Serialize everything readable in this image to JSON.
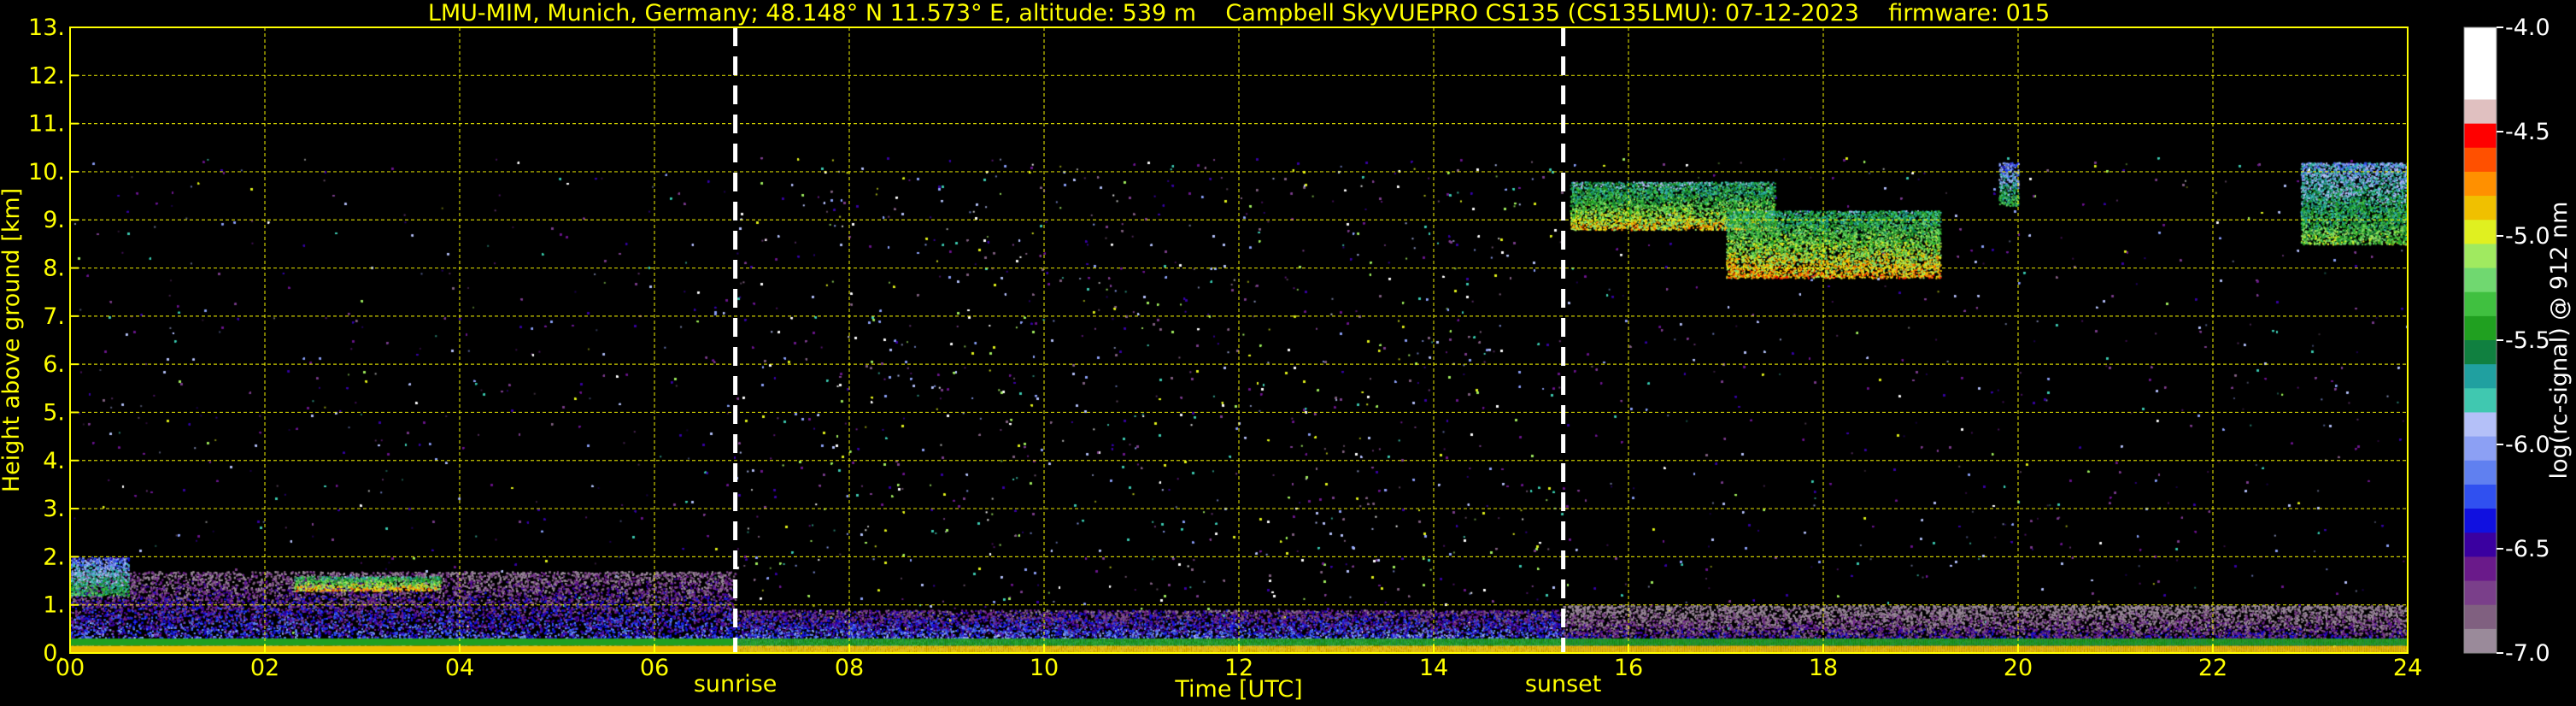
{
  "chart_data": {
    "type": "heatmap",
    "title": "LMU-MIM, Munich, Germany; 48.148° N 11.573° E, altitude: 539 m    Campbell SkyVUEPRO CS135 (CS135LMU): 07-12-2023    firmware: 015",
    "xlabel": "Time [UTC]",
    "ylabel": "Height above ground [km]",
    "xlim": [
      0,
      24
    ],
    "ylim": [
      0,
      13
    ],
    "xticks": [
      0,
      2,
      4,
      6,
      8,
      10,
      12,
      14,
      16,
      18,
      20,
      22,
      24
    ],
    "xtick_labels": [
      "00",
      "02",
      "04",
      "06",
      "08",
      "10",
      "12",
      "14",
      "16",
      "18",
      "20",
      "22",
      "24"
    ],
    "yticks": [
      0,
      1,
      2,
      3,
      4,
      5,
      6,
      7,
      8,
      9,
      10,
      11,
      12,
      13
    ],
    "ytick_labels": [
      "0.",
      "1.",
      "2.",
      "3.",
      "4.",
      "5.",
      "6.",
      "7.",
      "8.",
      "9.",
      "10.",
      "11.",
      "12.",
      "13."
    ],
    "grid": true,
    "data_top_km": 10.3,
    "markers": [
      {
        "label": "sunrise",
        "x": 6.83
      },
      {
        "label": "sunset",
        "x": 15.33
      }
    ],
    "colorbar": {
      "label": "log(rc-signal) @ 912 nm",
      "range": [
        -7.0,
        -4.0
      ],
      "ticks": [
        -7.0,
        -6.5,
        -6.0,
        -5.5,
        -5.0,
        -4.5,
        -4.0
      ],
      "tick_labels": [
        "-7.0",
        "-6.5",
        "-6.0",
        "-5.5",
        "-5.0",
        "-4.5",
        "-4.0"
      ],
      "colors": [
        "#9a8a9a",
        "#806080",
        "#7a3f8a",
        "#6a1a8a",
        "#3a00a0",
        "#1010e0",
        "#3050f0",
        "#6080f0",
        "#8ca0f4",
        "#b4c0f8",
        "#40c8b0",
        "#20a0a0",
        "#108040",
        "#20a020",
        "#40c040",
        "#70d870",
        "#a0ea60",
        "#e0f020",
        "#f0c000",
        "#ff9000",
        "#ff5000",
        "#ff0000",
        "#e0c0c0",
        "#ffffff",
        "#ffffff",
        "#ffffff"
      ]
    },
    "regions": [
      {
        "feature": "boundary-layer aerosol",
        "x": [
          0,
          6.83
        ],
        "height_km": [
          0,
          1.7
        ],
        "level": -6.5
      },
      {
        "feature": "low cloud",
        "x": [
          2.3,
          3.8
        ],
        "height_km": [
          1.3,
          1.6
        ],
        "level": -5.2
      },
      {
        "feature": "low cloud",
        "x": [
          0,
          0.6
        ],
        "height_km": [
          1.2,
          2.0
        ],
        "level": -5.8
      },
      {
        "feature": "boundary-layer aerosol",
        "x": [
          6.83,
          15.33
        ],
        "height_km": [
          0,
          0.9
        ],
        "level": -6.3
      },
      {
        "feature": "boundary-layer aerosol",
        "x": [
          15.33,
          24
        ],
        "height_km": [
          0,
          1.0
        ],
        "level": -6.7
      },
      {
        "feature": "cirrus",
        "x": [
          15.4,
          17.5
        ],
        "height_km": [
          8.8,
          9.8
        ],
        "level": -5.3
      },
      {
        "feature": "cirrus",
        "x": [
          17.0,
          19.2
        ],
        "height_km": [
          7.8,
          9.2
        ],
        "level": -5.2
      },
      {
        "feature": "cirrus",
        "x": [
          19.8,
          20.0
        ],
        "height_km": [
          9.3,
          10.2
        ],
        "level": -5.8
      },
      {
        "feature": "cirrus",
        "x": [
          22.9,
          24
        ],
        "height_km": [
          8.5,
          10.2
        ],
        "level": -5.6
      }
    ]
  }
}
